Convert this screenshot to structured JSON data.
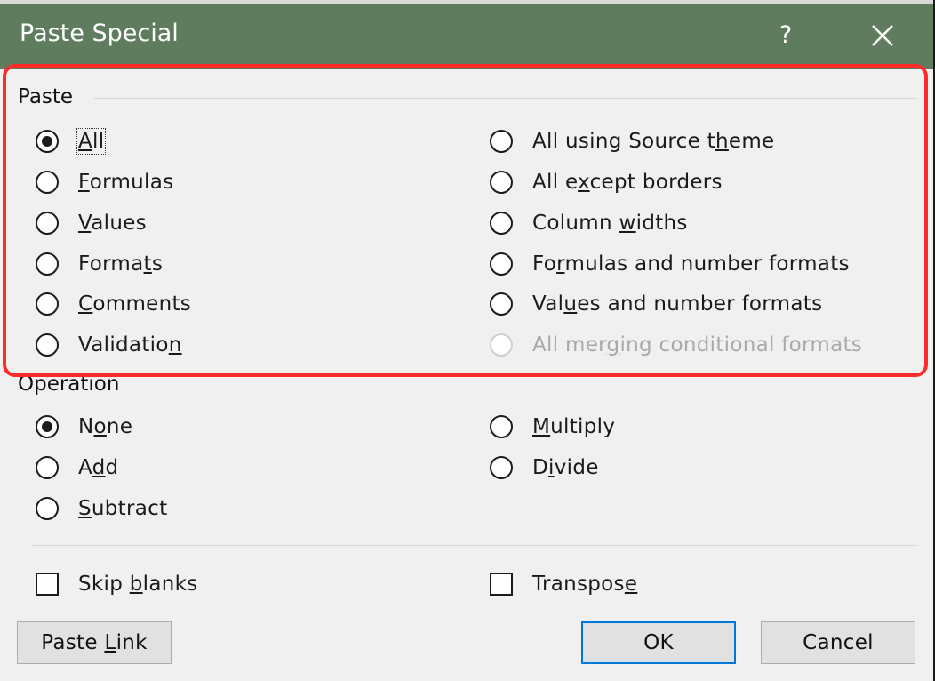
{
  "title": "Paste Special",
  "help_label": "?",
  "paste_group": {
    "label": "Paste",
    "options": [
      {
        "pre": "",
        "u": "A",
        "post": "ll"
      },
      {
        "pre": "",
        "u": "F",
        "post": "ormulas"
      },
      {
        "pre": "",
        "u": "V",
        "post": "alues"
      },
      {
        "pre": "Forma",
        "u": "t",
        "post": "s"
      },
      {
        "pre": "",
        "u": "C",
        "post": "omments"
      },
      {
        "pre": "Validatio",
        "u": "n",
        "post": ""
      },
      {
        "pre": "All using Source t",
        "u": "h",
        "post": "eme"
      },
      {
        "pre": "All e",
        "u": "x",
        "post": "cept borders"
      },
      {
        "pre": "Column ",
        "u": "w",
        "post": "idths"
      },
      {
        "pre": "Fo",
        "u": "r",
        "post": "mulas and number formats"
      },
      {
        "pre": "Val",
        "u": "u",
        "post": "es and number formats"
      },
      {
        "pre": "All mer",
        "u": "g",
        "post": "ing conditional formats"
      }
    ]
  },
  "operation_group": {
    "label": "Operation",
    "options": [
      {
        "pre": "N",
        "u": "o",
        "post": "ne"
      },
      {
        "pre": "A",
        "u": "d",
        "post": "d"
      },
      {
        "pre": "",
        "u": "S",
        "post": "ubtract"
      },
      {
        "pre": "",
        "u": "M",
        "post": "ultiply"
      },
      {
        "pre": "D",
        "u": "i",
        "post": "vide"
      }
    ]
  },
  "checkboxes": {
    "skip_blanks": {
      "pre": "Skip ",
      "u": "b",
      "post": "lanks"
    },
    "transpose": {
      "pre": "Transpos",
      "u": "e",
      "post": ""
    }
  },
  "buttons": {
    "paste_link": {
      "pre": "Paste ",
      "u": "L",
      "post": "ink"
    },
    "ok": "OK",
    "cancel": "Cancel"
  },
  "colors": {
    "titlebar": "#5f7c5e",
    "highlight": "#ff2b2b",
    "default_button_border": "#0078d7"
  }
}
